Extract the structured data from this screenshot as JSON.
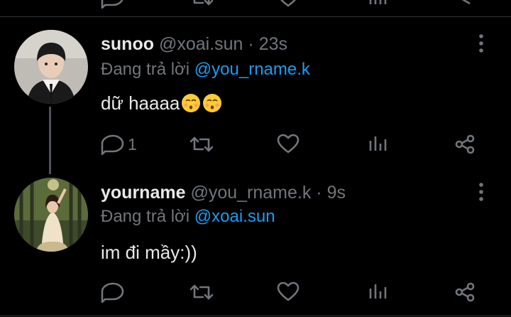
{
  "tweets": [
    {
      "name": "sunoo",
      "handle": "@xoai.sun",
      "separator": "·",
      "time": "23s",
      "reply_prefix": "Đang trả lời",
      "reply_to": "@you_rname.k",
      "text": "dữ haaaa",
      "emoji": "kissing-face-with-closed-eyes",
      "reply_count": "1"
    },
    {
      "name": "yourname",
      "handle": "@you_rname.k",
      "separator": "·",
      "time": "9s",
      "reply_prefix": "Đang trả lời",
      "reply_to": "@xoai.sun",
      "text": "im đi mầy:))",
      "reply_count": ""
    }
  ],
  "icons": {
    "actions": [
      "reply-icon",
      "retweet-icon",
      "like-icon",
      "views-icon",
      "share-icon"
    ],
    "menu": "more-options-icon"
  },
  "colors": {
    "background": "#000000",
    "text": "#e7e9ea",
    "muted": "#71767b",
    "mention": "#1d9bf0",
    "divider": "#2f3336"
  }
}
